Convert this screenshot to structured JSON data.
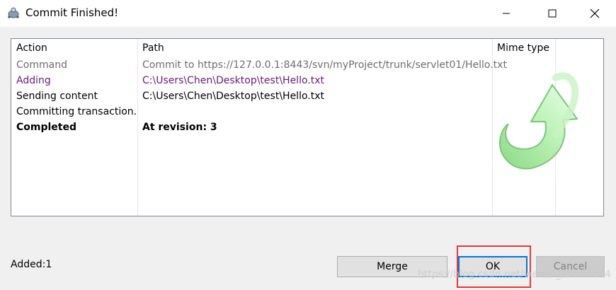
{
  "window": {
    "title": "Commit Finished!",
    "icon": "tortoise-icon",
    "controls": [
      "minimize-icon",
      "maximize-icon",
      "close-icon"
    ]
  },
  "list": {
    "columns": [
      "Action",
      "Path",
      "Mime type"
    ],
    "rows": [
      {
        "action": "Command",
        "path": "Commit to https://127.0.0.1:8443/svn/myProject/trunk/servlet01/Hello.txt",
        "color": "#6d6d6d",
        "bold": false
      },
      {
        "action": "Adding",
        "path": "C:\\Users\\Chen\\Desktop\\test\\Hello.txt",
        "color": "#6a1b77",
        "bold": false
      },
      {
        "action": "Sending content",
        "path": "C:\\Users\\Chen\\Desktop\\test\\Hello.txt",
        "color": "#000000",
        "bold": false
      },
      {
        "action": "Committing transaction...",
        "path": "",
        "color": "#000000",
        "bold": false
      },
      {
        "action": "Completed",
        "path": "At revision: 3",
        "color": "#000000",
        "bold": true
      }
    ],
    "decoration": "green-curved-arrow-icon"
  },
  "footer": {
    "status": "Added:1",
    "merge_label": "Merge",
    "ok_label": "OK",
    "cancel_label": "Cancel",
    "watermark": "https://blog.csdn.net/weixin_45959844"
  },
  "colors": {
    "highlight": "#e53935",
    "focus_blue": "#0078d7",
    "adding_purple": "#6a1b77",
    "command_gray": "#6d6d6d"
  }
}
